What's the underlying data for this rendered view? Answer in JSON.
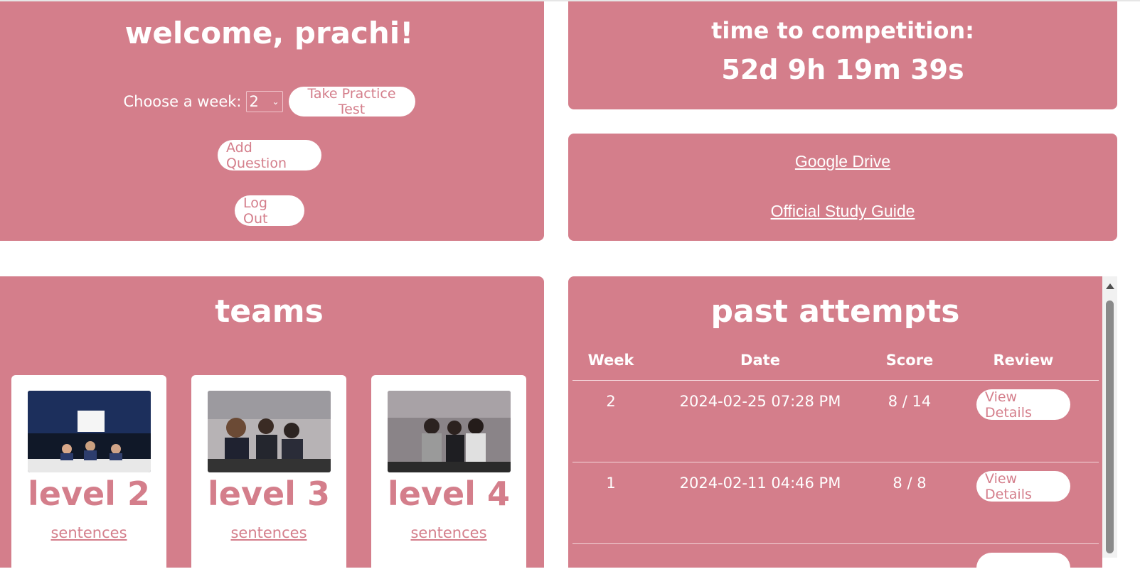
{
  "welcome": {
    "title": "welcome, prachi!",
    "choose_week_label": "Choose a week:",
    "week_value": "2",
    "take_test_label": "Take Practice Test",
    "add_question_label": "Add Question",
    "logout_label": "Log Out"
  },
  "timer": {
    "label": "time to competition:",
    "value": "52d 9h 19m 39s"
  },
  "links": {
    "drive": "Google Drive",
    "study_guide": "Official Study Guide"
  },
  "teams": {
    "title": "teams",
    "cards": [
      {
        "level": "level 2",
        "link": "sentences"
      },
      {
        "level": "level 3",
        "link": "sentences"
      },
      {
        "level": "level 4",
        "link": "sentences"
      }
    ]
  },
  "attempts": {
    "title": "past attempts",
    "headers": [
      "Week",
      "Date",
      "Score",
      "Review"
    ],
    "rows": [
      {
        "week": "2",
        "date": "2024-02-25 07:28 PM",
        "score": "8 / 14",
        "review": "View Details"
      },
      {
        "week": "1",
        "date": "2024-02-11 04:46 PM",
        "score": "8 / 8",
        "review": "View Details"
      }
    ]
  },
  "colors": {
    "panel": "#d47e8b",
    "text": "#ffffff"
  }
}
